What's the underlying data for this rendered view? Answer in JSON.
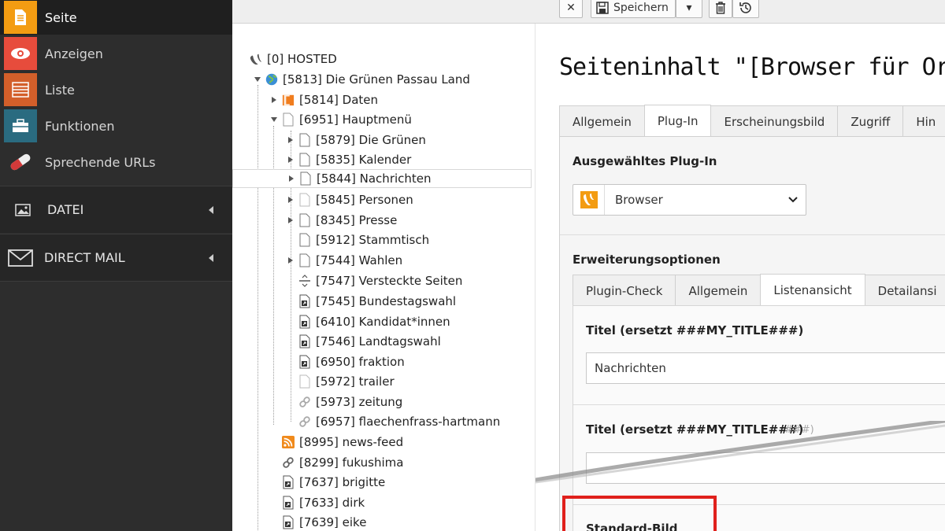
{
  "sidebar": {
    "modules": [
      {
        "label": "Seite",
        "icon": "page-icon",
        "color": "#f39c12"
      },
      {
        "label": "Anzeigen",
        "icon": "eye-icon",
        "color": "#e74c3c"
      },
      {
        "label": "Liste",
        "icon": "list-icon",
        "color": "#d35f2a"
      },
      {
        "label": "Funktionen",
        "icon": "toolbox-icon",
        "color": "#2a6b80"
      },
      {
        "label": "Sprechende URLs",
        "icon": "pill-icon",
        "color": "#d23a3a"
      }
    ],
    "groups": [
      {
        "label": "DATEI",
        "icon": "image-icon"
      },
      {
        "label": "DIRECT MAIL",
        "icon": "envelope-icon"
      }
    ]
  },
  "toolbar": {
    "close_label": "✕",
    "save_label": "Speichern",
    "dropdown_label": "▾",
    "delete_label": "🗑",
    "history_label": "⟲"
  },
  "tree": {
    "rows": [
      {
        "label": "[0] HOSTED",
        "icon": "typo3-icon"
      },
      {
        "label": "[5813] Die Grünen Passau Land",
        "icon": "globe-icon"
      },
      {
        "label": "[5814] Daten",
        "icon": "folder-icon"
      },
      {
        "label": "[6951] Hauptmenü",
        "icon": "page-icon"
      },
      {
        "label": "[5879] Die Grünen",
        "icon": "page-icon"
      },
      {
        "label": "[5835] Kalender",
        "icon": "page-icon"
      },
      {
        "label": "[5844] Nachrichten",
        "icon": "page-icon"
      },
      {
        "label": "[5845] Personen",
        "icon": "page-icon"
      },
      {
        "label": "[8345] Presse",
        "icon": "page-icon"
      },
      {
        "label": "[5912] Stammtisch",
        "icon": "page-icon"
      },
      {
        "label": "[7544] Wahlen",
        "icon": "page-icon"
      },
      {
        "label": "[7547] Versteckte Seiten",
        "icon": "separator-icon"
      },
      {
        "label": "[7545] Bundestagswahl",
        "icon": "shortcut-icon"
      },
      {
        "label": "[6410] Kandidat*innen",
        "icon": "shortcut-icon"
      },
      {
        "label": "[7546] Landtagswahl",
        "icon": "shortcut-icon"
      },
      {
        "label": "[6950] fraktion",
        "icon": "shortcut-icon"
      },
      {
        "label": "[5972] trailer",
        "icon": "page-icon"
      },
      {
        "label": "[5973] zeitung",
        "icon": "link-icon"
      },
      {
        "label": "[6957] flaechenfrass-hartmann",
        "icon": "link-icon"
      },
      {
        "label": "[8995] news-feed",
        "icon": "rss-icon"
      },
      {
        "label": "[8299] fukushima",
        "icon": "link-icon"
      },
      {
        "label": "[7637] brigitte",
        "icon": "shortcut-icon"
      },
      {
        "label": "[7633] dirk",
        "icon": "shortcut-icon"
      },
      {
        "label": "[7639] eike",
        "icon": "shortcut-icon"
      }
    ]
  },
  "content": {
    "title": "Seiteninhalt \"[Browser für Organise",
    "tabs": [
      "Allgemein",
      "Plug-In",
      "Erscheinungsbild",
      "Zugriff",
      "Hin"
    ],
    "plugin_section_label": "Ausgewähltes Plug-In",
    "plugin_select_value": "Browser",
    "ext_section_label": "Erweiterungsoptionen",
    "ext_tabs": [
      "Plugin-Check",
      "Allgemein",
      "Listenansicht",
      "Detailansi"
    ],
    "field1_label": "Titel (ersetzt ###MY_TITLE###)",
    "field1_value": "Nachrichten",
    "field2_label": "Titel (ersetzt ###MY_TITLE###)",
    "field2_overlay": "###)",
    "field2_value": "",
    "field3_label": "Standard-Bild",
    "highlight_color": "#e0201c"
  }
}
